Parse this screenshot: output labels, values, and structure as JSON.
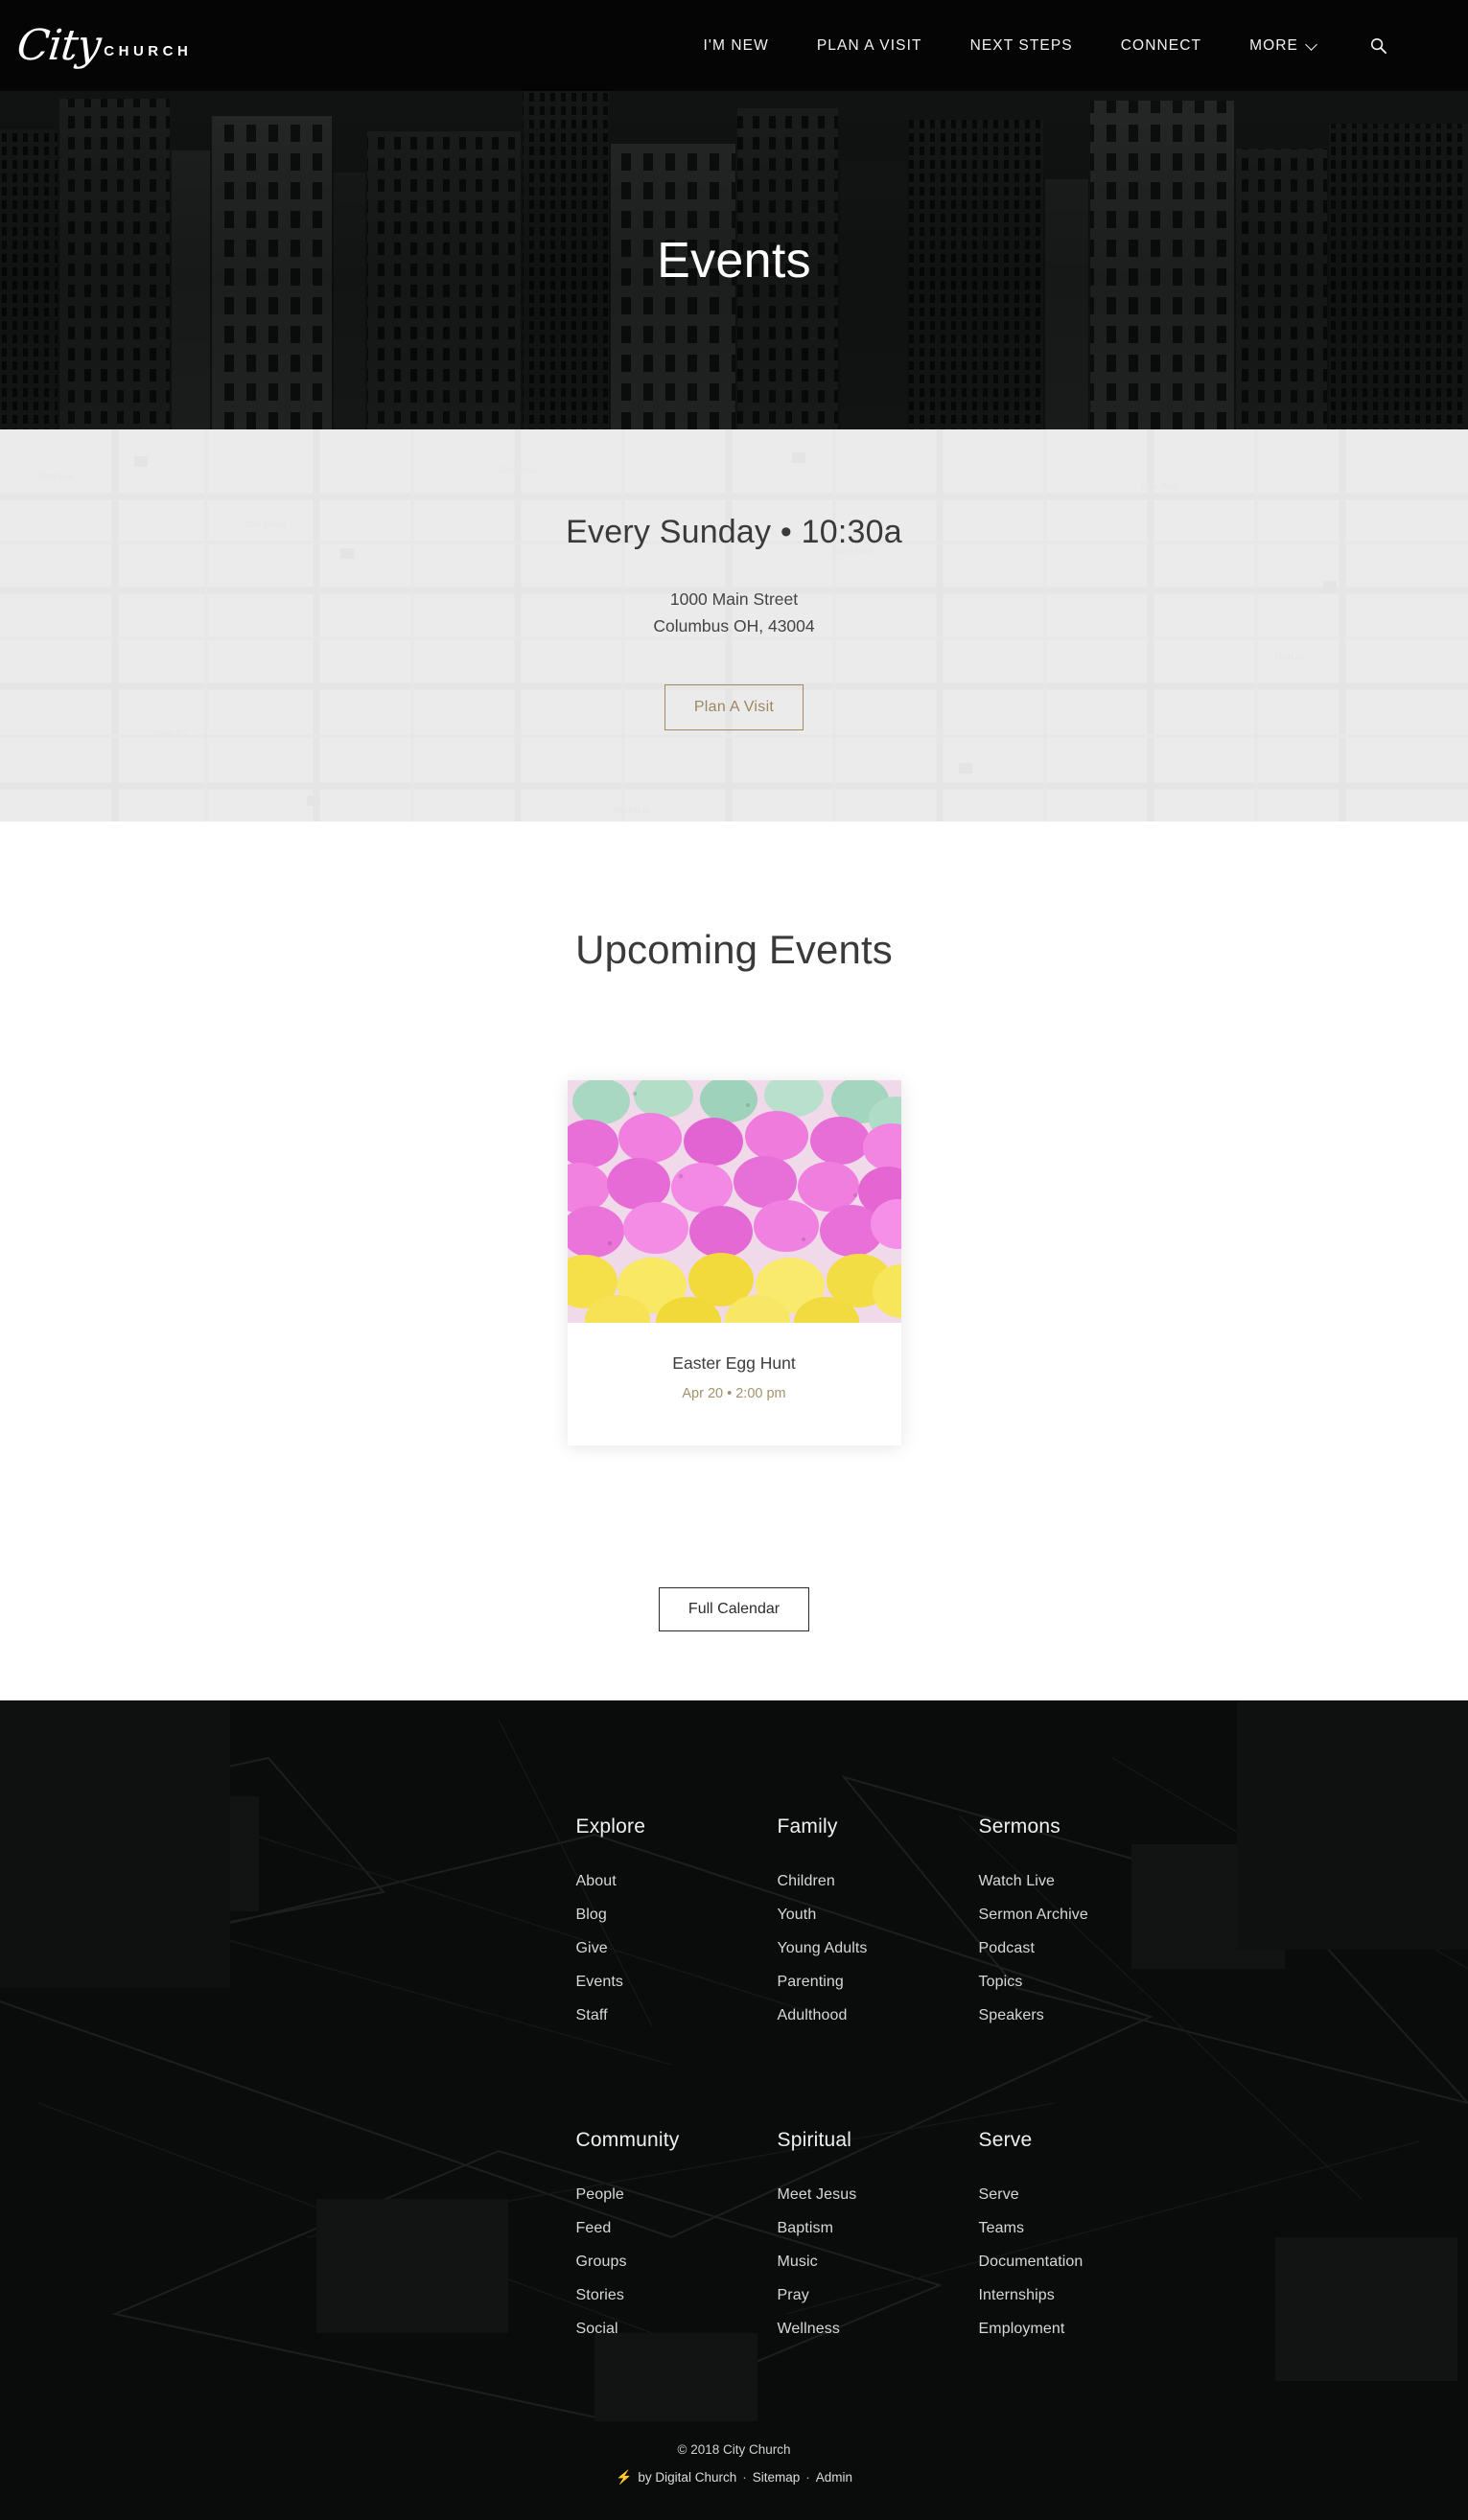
{
  "header": {
    "logo_script": "City",
    "logo_word": "CHURCH",
    "nav": [
      {
        "label": "I'M NEW",
        "has_chevron": false
      },
      {
        "label": "PLAN A VISIT",
        "has_chevron": false
      },
      {
        "label": "NEXT STEPS",
        "has_chevron": false
      },
      {
        "label": "CONNECT",
        "has_chevron": false
      },
      {
        "label": "MORE",
        "has_chevron": true
      }
    ],
    "search_icon": "search-icon"
  },
  "hero": {
    "title": "Events"
  },
  "service": {
    "time": "Every Sunday • 10:30a",
    "address_line1": "1000 Main Street",
    "address_line2": "Columbus OH, 43004",
    "button_label": "Plan A Visit",
    "accent_color": "#9c8760"
  },
  "events": {
    "title": "Upcoming Events",
    "cards": [
      {
        "title": "Easter Egg Hunt",
        "date": "Apr 20 • 2:00 pm",
        "image": "easter-eggs-photo"
      }
    ],
    "calendar_button": "Full Calendar"
  },
  "footer": {
    "columns": [
      {
        "heading": "Explore",
        "links": [
          "About",
          "Blog",
          "Give",
          "Events",
          "Staff"
        ]
      },
      {
        "heading": "Family",
        "links": [
          "Children",
          "Youth",
          "Young Adults",
          "Parenting",
          "Adulthood"
        ]
      },
      {
        "heading": "Sermons",
        "links": [
          "Watch Live",
          "Sermon Archive",
          "Podcast",
          "Topics",
          "Speakers"
        ]
      },
      {
        "heading": "Community",
        "links": [
          "People",
          "Feed",
          "Groups",
          "Stories",
          "Social"
        ]
      },
      {
        "heading": "Spiritual",
        "links": [
          "Meet Jesus",
          "Baptism",
          "Music",
          "Pray",
          "Wellness"
        ]
      },
      {
        "heading": "Serve",
        "links": [
          "Serve",
          "Teams",
          "Documentation",
          "Internships",
          "Employment"
        ]
      }
    ],
    "copyright": "© 2018 City Church",
    "credit_prefix": "by Digital Church",
    "sitemap_label": "Sitemap",
    "admin_label": "Admin",
    "separator": "·"
  }
}
